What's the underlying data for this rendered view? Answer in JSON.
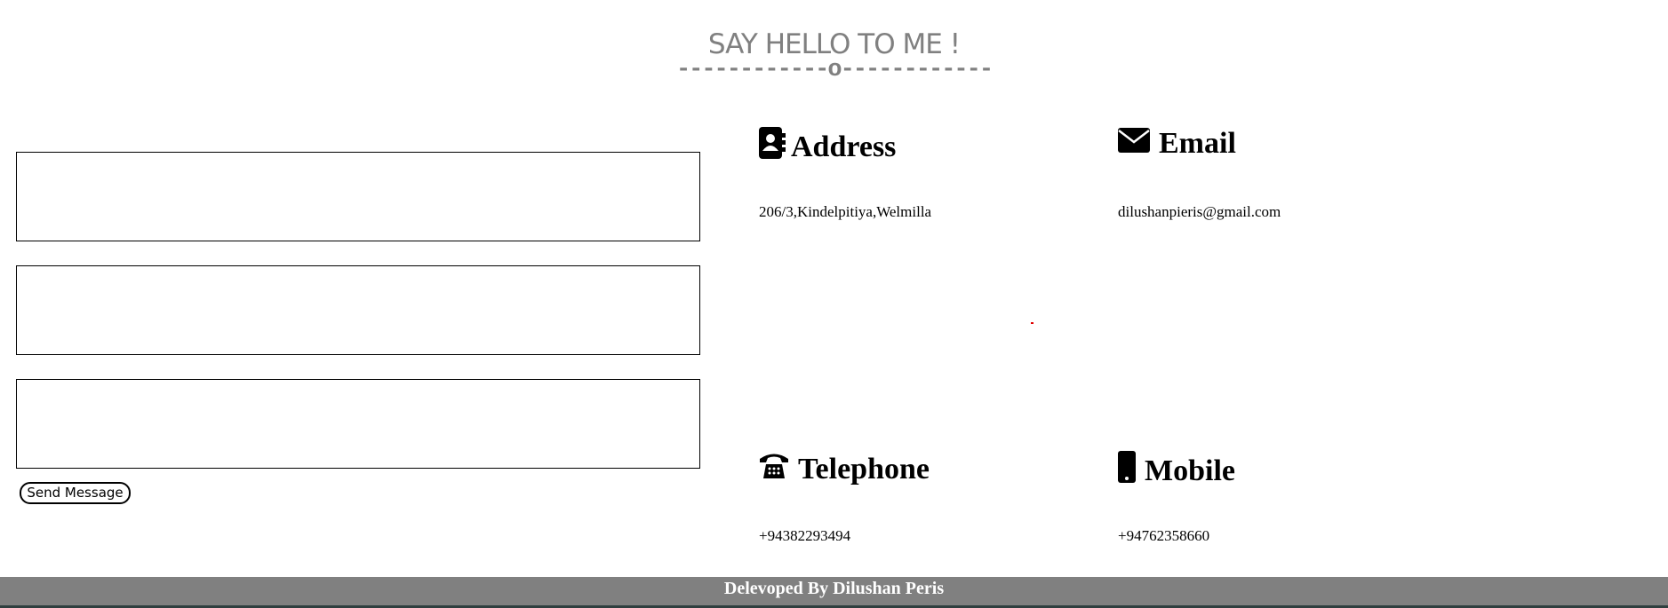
{
  "header": {
    "title": "SAY HELLO TO ME !",
    "divider": "------------o------------"
  },
  "form": {
    "fields": [
      "",
      "",
      ""
    ],
    "send_label": "Send Message"
  },
  "contact": {
    "address": {
      "title": "Address",
      "value": "206/3,Kindelpitiya,Welmilla",
      "icon": "address-book-icon"
    },
    "email": {
      "title": "Email",
      "value": "dilushanpieris@gmail.com",
      "icon": "envelope-icon"
    },
    "telephone": {
      "title": "Telephone",
      "value": "+94382293494",
      "icon": "telephone-icon"
    },
    "mobile": {
      "title": "Mobile",
      "value": "+94762358660",
      "icon": "mobile-phone-icon"
    }
  },
  "footer": {
    "text": "Delevoped By Dilushan Peris"
  },
  "colors": {
    "heading": "#808080",
    "footer_bg": "#808080",
    "footer_text": "#ffffff"
  }
}
